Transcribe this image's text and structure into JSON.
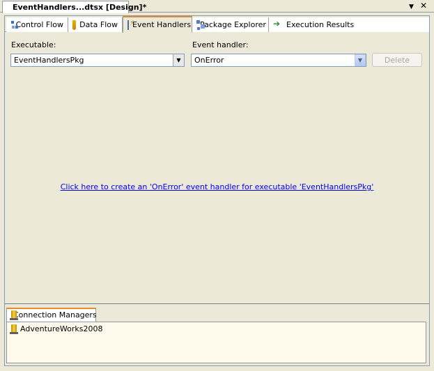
{
  "document": {
    "tab_title": "EventHandlers...dtsx [Design]*",
    "pin_glyph": "▼",
    "close_glyph": "✕"
  },
  "view_tabs": [
    {
      "label": "Control Flow",
      "icon": "control-flow-icon",
      "active": false
    },
    {
      "label": "Data Flow",
      "icon": "data-flow-icon",
      "active": false
    },
    {
      "label": "Event Handlers",
      "icon": "event-handlers-icon",
      "active": true
    },
    {
      "label": "Package Explorer",
      "icon": "package-explorer-icon",
      "active": false
    },
    {
      "label": "Execution Results",
      "icon": "execution-results-icon",
      "active": false
    }
  ],
  "executable": {
    "label": "Executable:",
    "value": "EventHandlersPkg"
  },
  "event_handler": {
    "label": "Event handler:",
    "value": "OnError"
  },
  "delete_button": {
    "label": "Delete",
    "enabled": false
  },
  "create_link": "Click here to create an 'OnError' event handler for executable 'EventHandlersPkg'",
  "connection_managers": {
    "tab_label": "Connection Managers",
    "items": [
      "AdventureWorks2008"
    ]
  },
  "colors": {
    "background": "#ece9d8",
    "active_tab_accent": "#e68b2c",
    "link": "#0000ee",
    "connection_panel": "#fffaeb"
  }
}
